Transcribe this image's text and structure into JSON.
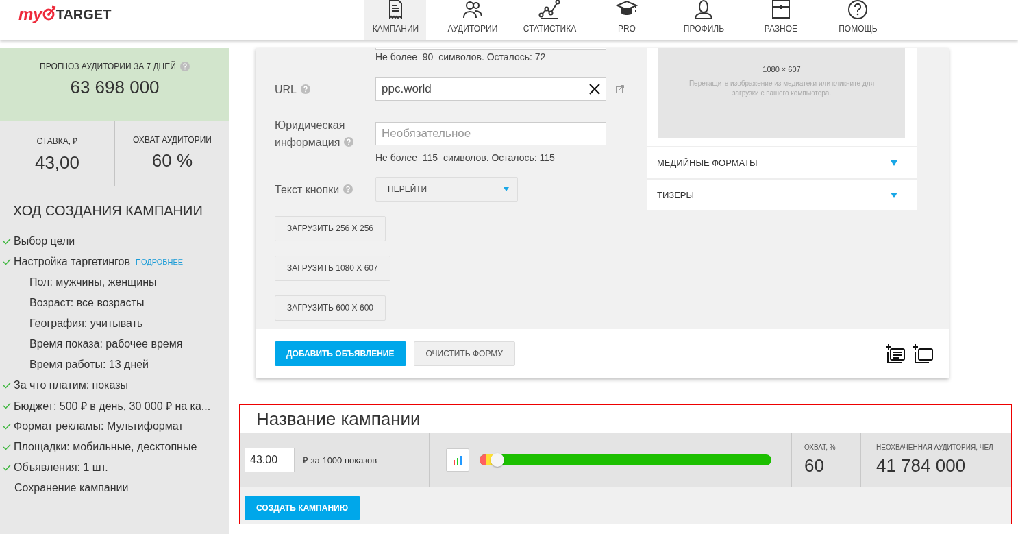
{
  "header": {
    "logo": {
      "prefix": "my",
      "suffix": "TARGET"
    },
    "nav": [
      {
        "label": "КАМПАНИИ",
        "kind": "document",
        "selected": true
      },
      {
        "label": "АУДИТОРИИ",
        "kind": "people",
        "selected": false
      },
      {
        "label": "СТАТИСТИКА",
        "kind": "chart",
        "selected": false
      },
      {
        "label": "PRO",
        "kind": "cap",
        "selected": false
      },
      {
        "label": "ПРОФИЛЬ",
        "kind": "person",
        "selected": false
      },
      {
        "label": "РАЗНОЕ",
        "kind": "panel",
        "selected": false
      },
      {
        "label": "ПОМОЩЬ",
        "kind": "help",
        "selected": false
      }
    ]
  },
  "sidebar": {
    "forecast": {
      "label": "ПРОГНОЗ АУДИТОРИИ ЗА 7 ДНЕЙ",
      "value": "63 698 000"
    },
    "stats": [
      {
        "label": "СТАВКА, ₽",
        "value": "43,00"
      },
      {
        "label": "ОХВАТ АУДИТОРИИ",
        "value": "60 %"
      }
    ],
    "progress": {
      "title": "ХОД СОЗДАНИЯ КАМПАНИИ",
      "steps": [
        {
          "text": "Выбор цели",
          "done": true
        },
        {
          "text": "Настройка таргетингов",
          "done": true,
          "link": "ПОДРОБНЕЕ",
          "children": [
            {
              "text": "Пол: мужчины, женщины"
            },
            {
              "text": "Возраст: все возрасты"
            },
            {
              "text": "География: учитывать"
            },
            {
              "text": "Время показа: рабочее время"
            },
            {
              "text": "Время работы: 13 дней"
            }
          ]
        },
        {
          "text": "За что платим: показы",
          "done": true
        },
        {
          "text": "Бюджет: 500 ₽ в день, 30 000 ₽ на ка...",
          "done": true
        },
        {
          "text": "Формат рекламы: Мультиформат",
          "done": true
        },
        {
          "text": "Площадки: мобильные, десктопные",
          "done": true
        },
        {
          "text": "Объявления: 1 шт.",
          "done": true
        },
        {
          "text": "Сохранение кампании",
          "done": false
        }
      ]
    }
  },
  "ad_form": {
    "top_hint": "Не более  90  символов. Осталось: 72",
    "fields": [
      {
        "kind": "text",
        "label": "URL",
        "value": "ppc.world"
      },
      {
        "kind": "text",
        "label": "Юридическая информация",
        "placeholder": "Необязательное",
        "hint": "Не более  115  символов. Осталось: 115"
      },
      {
        "kind": "select",
        "label": "Текст кнопки",
        "value": "ПЕРЕЙТИ"
      }
    ],
    "upload_buttons": [
      "ЗАГРУЗИТЬ 256 X 256",
      "ЗАГРУЗИТЬ 1080 X 607",
      "ЗАГРУЗИТЬ 600 X 600"
    ],
    "image_drop": {
      "size": "1080 × 607",
      "hint": "Перетащите изображение из медиатеки или кликните для загрузки с вашего компьютера."
    },
    "sections": [
      {
        "label": "МЕДИЙНЫЕ ФОРМАТЫ",
        "expanded": false
      },
      {
        "label": "ТИЗЕРЫ",
        "expanded": false
      }
    ],
    "buttons": [
      {
        "label": "ДОБАВИТЬ ОБЪЯВЛЕНИЕ",
        "kind": "primary"
      },
      {
        "label": "ОЧИСТИТЬ ФОРМУ",
        "kind": "secondary"
      }
    ]
  },
  "campaign": {
    "title": "Название кампании",
    "bid": {
      "value": "43.00",
      "unit": "₽ за 1000 показов"
    },
    "slider": {
      "level": 0.06
    },
    "coverage": {
      "label": "ОХВАТ, %",
      "value": "60"
    },
    "unreached": {
      "label": "НЕОХВАЧЕННАЯ АУДИТОРИЯ, ЧЕЛ",
      "value": "41 784 000"
    },
    "create_button": "СОЗДАТЬ КАМПАНИЮ"
  }
}
